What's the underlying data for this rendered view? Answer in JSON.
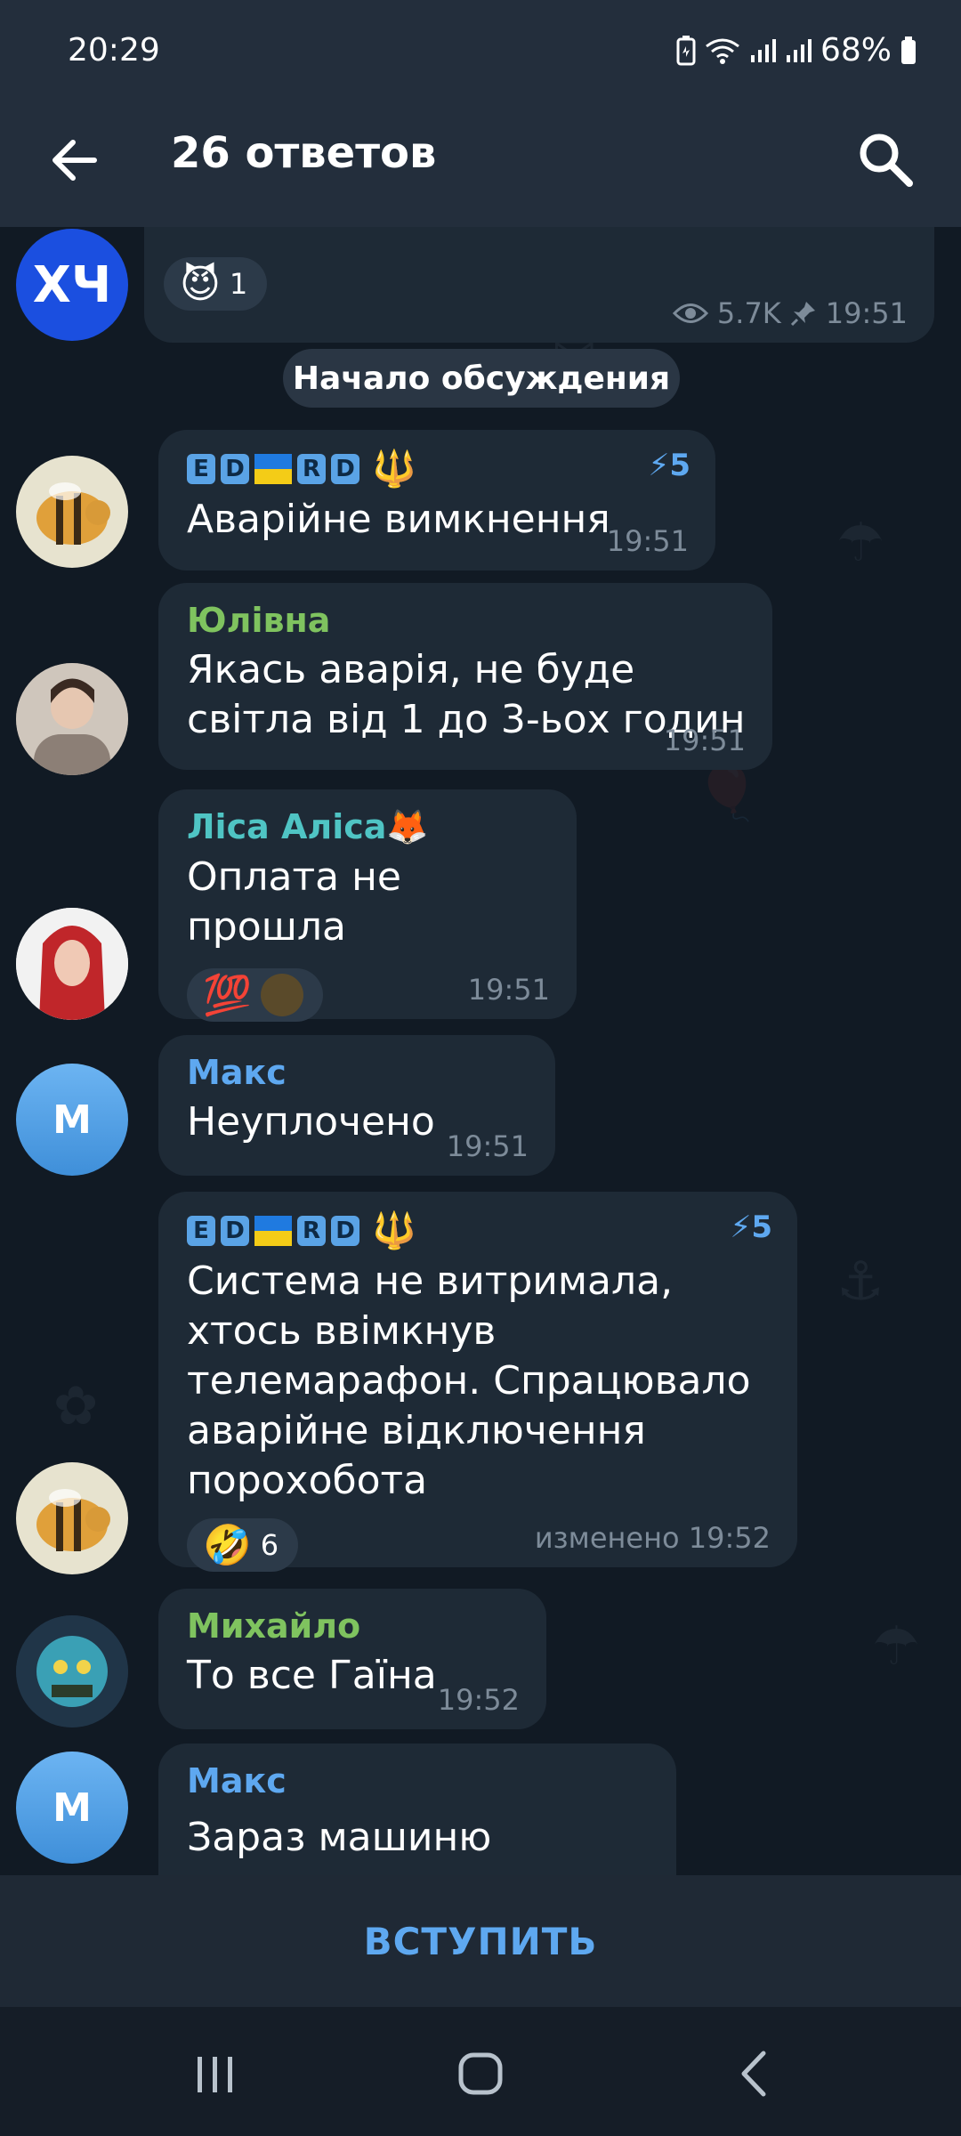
{
  "status_bar": {
    "time": "20:29",
    "battery": "68%"
  },
  "header": {
    "title": "26 ответов"
  },
  "top_message": {
    "avatar_text": "ХЧ",
    "reaction_emoji": "😈",
    "reaction_count": "1",
    "views": "5.7K",
    "time": "19:51"
  },
  "divider": {
    "text": "Начало обсуждения"
  },
  "tag_letters": [
    "E",
    "D",
    "R",
    "D"
  ],
  "messages": [
    {
      "id": "m1",
      "text": "Аварійне вимкнення",
      "time": "19:51",
      "boost": "5"
    },
    {
      "id": "m2",
      "sender": "Юлівна",
      "sender_color": "#7fc35f",
      "text": "Якась аварія, не буде світла від 1 до 3-ьох годин",
      "time": "19:51"
    },
    {
      "id": "m3",
      "sender": "Ліса Аліса🦊",
      "sender_color": "#4fc4c4",
      "text": "Оплата не прошла",
      "reaction_emoji": "💯",
      "time": "19:51"
    },
    {
      "id": "m4",
      "sender": "Макс",
      "sender_color": "#5ea8f0",
      "avatar_letter": "M",
      "text": "Неуплочено",
      "time": "19:51"
    },
    {
      "id": "m5",
      "text": "Система не витримала, хтось ввімкнув телемарафон. Спрацювало аварійне відключення порохобота",
      "reaction_emoji": "🤣",
      "reaction_count": "6",
      "time": "изменено 19:52",
      "boost": "5"
    },
    {
      "id": "m6",
      "sender": "Михайло",
      "sender_color": "#7fc35f",
      "text": "То все Гаїна",
      "time": "19:52"
    },
    {
      "id": "m7",
      "sender": "Макс",
      "sender_color": "#5ea8f0",
      "avatar_letter": "M",
      "text": "Зараз машиню доварю"
    }
  ],
  "colors": {
    "bubble": "#1e2a36",
    "accent": "#5ea8f0",
    "background": "#111a24"
  },
  "icons": [
    "back-arrow-icon",
    "search-icon",
    "eye-icon",
    "pin-icon",
    "boost-icon",
    "trident-icon"
  ],
  "join_button": {
    "label": "ВСТУПИТЬ"
  }
}
